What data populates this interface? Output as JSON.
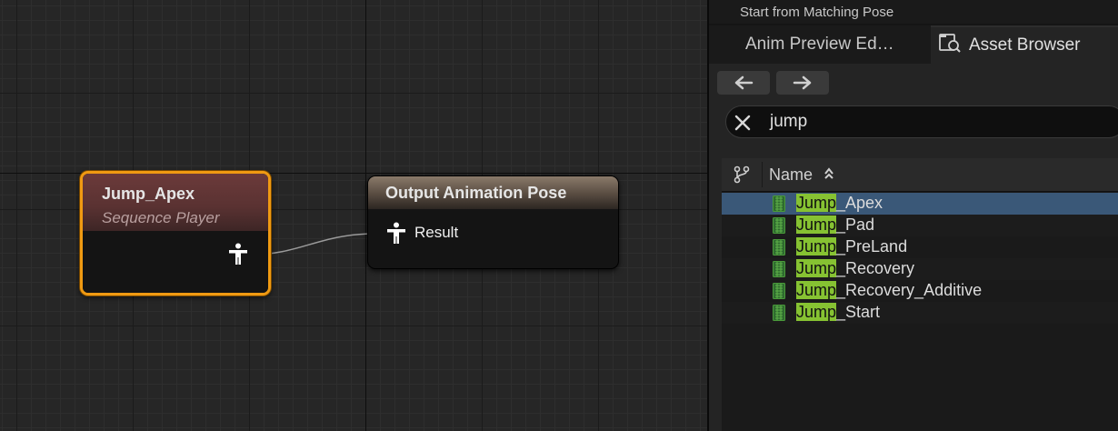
{
  "graph": {
    "node_sequence": {
      "title": "Jump_Apex",
      "subtitle": "Sequence Player"
    },
    "node_output": {
      "title": "Output Animation Pose",
      "pin_label": "Result"
    }
  },
  "panel": {
    "top_strip_text": "Start from Matching Pose",
    "tabs": [
      {
        "label": "Anim Preview Ed…",
        "active": false
      },
      {
        "label": "Asset Browser",
        "active": true,
        "icon": "asset-browser-icon"
      }
    ],
    "search": {
      "value": "jump"
    },
    "column_header": "Name",
    "highlight_term": "Jump",
    "items": [
      {
        "prefix": "Jump",
        "rest": "_Apex",
        "selected": true
      },
      {
        "prefix": "Jump",
        "rest": "_Pad",
        "selected": false
      },
      {
        "prefix": "Jump",
        "rest": "_PreLand",
        "selected": false
      },
      {
        "prefix": "Jump",
        "rest": "_Recovery",
        "selected": false
      },
      {
        "prefix": "Jump",
        "rest": "_Recovery_Additive",
        "selected": false
      },
      {
        "prefix": "Jump",
        "rest": "_Start",
        "selected": false
      }
    ]
  },
  "colors": {
    "selected_node_border": "#f09a12",
    "highlight": "#86c232",
    "selected_row": "#3a5878"
  }
}
